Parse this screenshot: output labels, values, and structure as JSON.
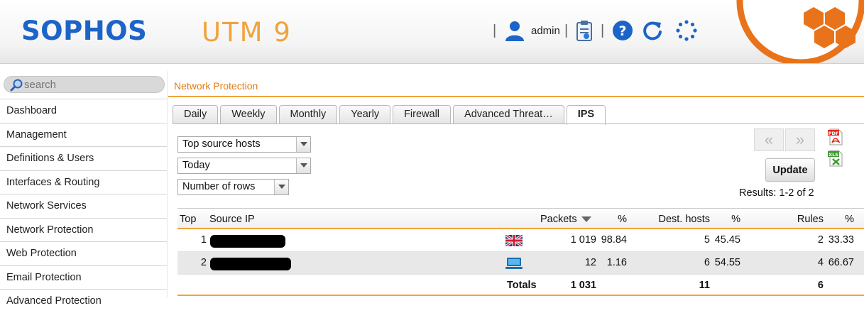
{
  "header": {
    "logo": "SOPHOS",
    "product": "UTM 9",
    "separator": "|",
    "username": "admin",
    "icons": [
      "user-icon",
      "clipboard-icon",
      "help-icon",
      "refresh-icon",
      "loading-icon"
    ],
    "brand_color": "#1c64c8",
    "accent_color": "#f0a33c"
  },
  "search": {
    "placeholder": "search"
  },
  "sidebar": {
    "items": [
      {
        "label": "Dashboard"
      },
      {
        "label": "Management"
      },
      {
        "label": "Definitions & Users"
      },
      {
        "label": "Interfaces & Routing"
      },
      {
        "label": "Network Services"
      },
      {
        "label": "Network Protection"
      },
      {
        "label": "Web Protection"
      },
      {
        "label": "Email Protection"
      },
      {
        "label": "Advanced Protection"
      }
    ]
  },
  "breadcrumb": "Network Protection",
  "tabs": [
    {
      "label": "Daily",
      "active": false
    },
    {
      "label": "Weekly",
      "active": false
    },
    {
      "label": "Monthly",
      "active": false
    },
    {
      "label": "Yearly",
      "active": false
    },
    {
      "label": "Firewall",
      "active": false
    },
    {
      "label": "Advanced Threat…",
      "active": false
    },
    {
      "label": "IPS",
      "active": true
    }
  ],
  "filters": {
    "report": "Top source hosts",
    "period": "Today",
    "rows": "Number of rows"
  },
  "pager": {
    "prev": "«",
    "next": "»"
  },
  "export": {
    "pdf": "pdf-icon",
    "xls": "xls-icon"
  },
  "update_label": "Update",
  "results": "Results: 1-2 of 2",
  "table": {
    "headers": {
      "top": "Top",
      "source_ip": "Source IP",
      "packets": "Packets",
      "packets_pct": "%",
      "dest_hosts": "Dest. hosts",
      "dest_pct": "%",
      "rules": "Rules",
      "rules_pct": "%"
    },
    "rows": [
      {
        "top": "1",
        "icon": "uk-flag-icon",
        "packets": "1 019",
        "packets_pct": "98.84",
        "dest_hosts": "5",
        "dest_pct": "45.45",
        "rules": "2",
        "rules_pct": "33.33"
      },
      {
        "top": "2",
        "icon": "computer-icon",
        "packets": "12",
        "packets_pct": "1.16",
        "dest_hosts": "6",
        "dest_pct": "54.55",
        "rules": "4",
        "rules_pct": "66.67"
      }
    ],
    "totals": {
      "label": "Totals",
      "packets": "1 031",
      "dest_hosts": "11",
      "rules": "6"
    }
  }
}
